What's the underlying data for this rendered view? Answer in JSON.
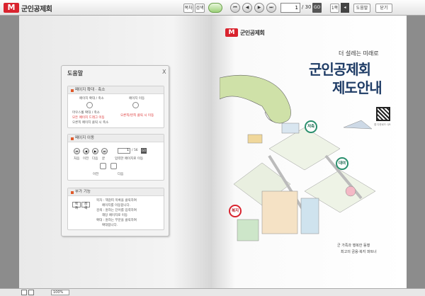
{
  "toolbar": {
    "brand": "군인공제회",
    "logo_letter": "M",
    "btn_print": "목차",
    "btn_search": "검색",
    "page_current": "1",
    "page_total": "/ 30",
    "go": "GO",
    "page_single": "1쪽",
    "page_double": "2쪽",
    "help": "도움말",
    "exit": "닫기"
  },
  "help_panel": {
    "title": "도움말",
    "close": "X",
    "zoom_section": {
      "title": "페이지 확대 · 축소",
      "left_caption": "페이지 확대 / 축소",
      "right_caption": "페이지 이동",
      "line1": "마우스휠 확대 / 축소",
      "line2": "모든 페이지 드래그 이동",
      "line3": "오른쪽 페이지 클릭 시 축소",
      "right_line": "오른쪽/왼쪽 클릭 시 이동"
    },
    "nav_section": {
      "title": "페이지 이동",
      "page_value": "1",
      "page_total": "/ 56",
      "go": "GO",
      "labels": [
        "처음",
        "이전",
        "다음",
        "끝",
        "입력한 페이지로 이동"
      ],
      "prev_label": "이전",
      "next_label": "다음"
    },
    "extra_section": {
      "title": "부가 기능",
      "btn_a": "목차",
      "btn_b": "검색",
      "line1": "목차 : 책갈피 목록을 클릭하여",
      "line2": "페이지를 이동합니다.",
      "line3": "검색 : 원하는 단어를 입력하여",
      "line4": "해당 페이지로 이동",
      "line5": "확대 : 원하는 부분을 클릭하여",
      "line6": "확대합니다."
    }
  },
  "cover": {
    "brand": "군인공제회",
    "logo_letter": "M",
    "subtitle": "더 설레는 미래로",
    "title_line1": "군인공제회",
    "title_line2": "제도안내",
    "qr_caption": "앱 다운로드 QR",
    "badge_save": "저축",
    "badge_loan": "대여",
    "badge_welfare": "복지",
    "footer_line1": "군 가족과 행복한 동행",
    "footer_line2": "최고의 금융·복지 파트너"
  },
  "bottombar": {
    "zoom": "100%"
  },
  "colors": {
    "brand_red": "#d9232e",
    "title_navy": "#1f3c66",
    "accent_green": "#2a8f6d"
  }
}
